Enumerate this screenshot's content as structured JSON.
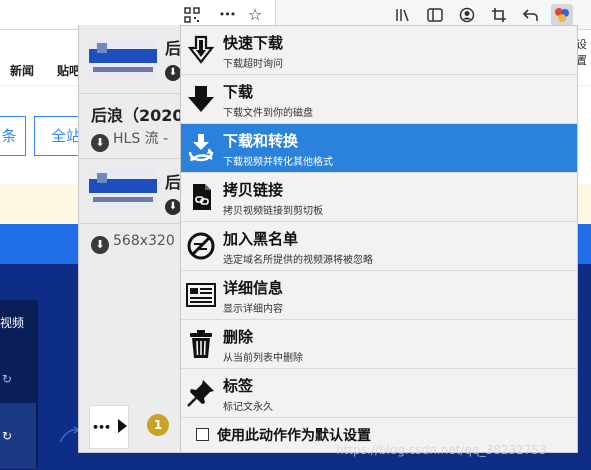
{
  "toolbar": {
    "icons": [
      "qr-code-icon",
      "more-horizontal-icon",
      "bookmark-star-icon",
      "library-icon",
      "reader-view-icon",
      "account-icon",
      "crop-icon",
      "undo-icon",
      "extension-icon"
    ],
    "more_glyph": "•••"
  },
  "background_page": {
    "nav_links": [
      "新闻",
      "贴吧"
    ],
    "search_button_label": "条",
    "scope_tab_label": "全站",
    "right_settings_text": "设置",
    "side_card_label": "视频"
  },
  "popup": {
    "videos": [
      {
        "side_text": "后",
        "has_download_icon": true
      },
      {
        "title": "后浪（2020",
        "subtitle": "HLS 流 -"
      },
      {
        "side_text": "后",
        "has_download_icon": true
      },
      {
        "subtitle": "568x320"
      }
    ],
    "more_button_label": "•••",
    "pending_count": "1",
    "actions": [
      {
        "icon": "quick-download-icon",
        "label": "快速下载",
        "desc": "下载超时询问",
        "selected": false
      },
      {
        "icon": "download-icon",
        "label": "下载",
        "desc": "下载文件到你的磁盘",
        "selected": false
      },
      {
        "icon": "download-convert-icon",
        "label": "下载和转换",
        "desc": "下载视频并转化其他格式",
        "selected": true
      },
      {
        "icon": "copy-link-icon",
        "label": "拷贝链接",
        "desc": "拷贝视频链接到剪切板",
        "selected": false
      },
      {
        "icon": "blacklist-icon",
        "label": "加入黑名单",
        "desc": "选定域名所提供的视频源将被忽略",
        "selected": false
      },
      {
        "icon": "details-icon",
        "label": "详细信息",
        "desc": "显示详细内容",
        "selected": false
      },
      {
        "icon": "trash-icon",
        "label": "删除",
        "desc": "从当前列表中删除",
        "selected": false
      },
      {
        "icon": "pin-icon",
        "label": "标签",
        "desc": "标记文永久",
        "selected": false
      }
    ],
    "default_setting_label": "使用此动作作为默认设置",
    "default_setting_checked": false
  },
  "watermark": "https://blog.csdn.net/qq_38232753",
  "colors": {
    "selected_bg": "#2a82da",
    "menu_bg": "#f2f2f2",
    "page_blue": "#1e6fe6",
    "page_dark": "#0e2d86",
    "badge": "#c9a227"
  }
}
